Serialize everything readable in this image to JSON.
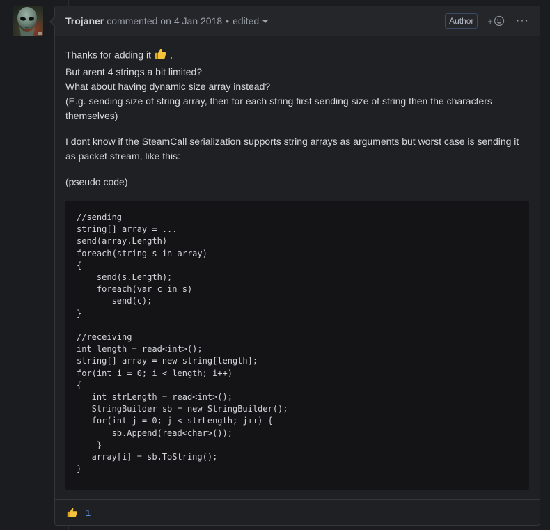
{
  "comment": {
    "author": "Trojaner",
    "action": "commented on",
    "date": "4 Jan 2018",
    "separator": "•",
    "edited_label": "edited",
    "role_badge": "Author",
    "menu_label": "···",
    "add_reaction_plus": "+"
  },
  "body": {
    "line1_before": "Thanks for adding it",
    "line1_after": ",",
    "line2": "But arent 4 strings a bit limited?",
    "line3": "What about having dynamic size array instead?",
    "line4": "(E.g. sending size of string array, then for each string first sending size of string then the characters themselves)",
    "para2": "I dont know if the SteamCall serialization supports string arrays as arguments but worst case is sending it as packet stream, like this:",
    "para3": "(pseudo code)",
    "code": "//sending\nstring[] array = ...\nsend(array.Length)\nforeach(string s in array)\n{\n    send(s.Length);\n    foreach(var c in s)\n       send(c);\n}\n\n//receiving\nint length = read<int>();\nstring[] array = new string[length];\nfor(int i = 0; i < length; i++)\n{\n   int strLength = read<int>();\n   StringBuilder sb = new StringBuilder();\n   for(int j = 0; j < strLength; j++) {\n       sb.Append(read<char>());\n    }\n   array[i] = sb.ToString();\n}"
  },
  "reactions": [
    {
      "icon": "thumbs-up-icon",
      "count": "1"
    }
  ],
  "colors": {
    "background": "#1b1c1f",
    "header": "#24262a",
    "code_bg": "#141416",
    "link_blue": "#5b8fd9",
    "thumb_yellow": "#f5c33b"
  }
}
